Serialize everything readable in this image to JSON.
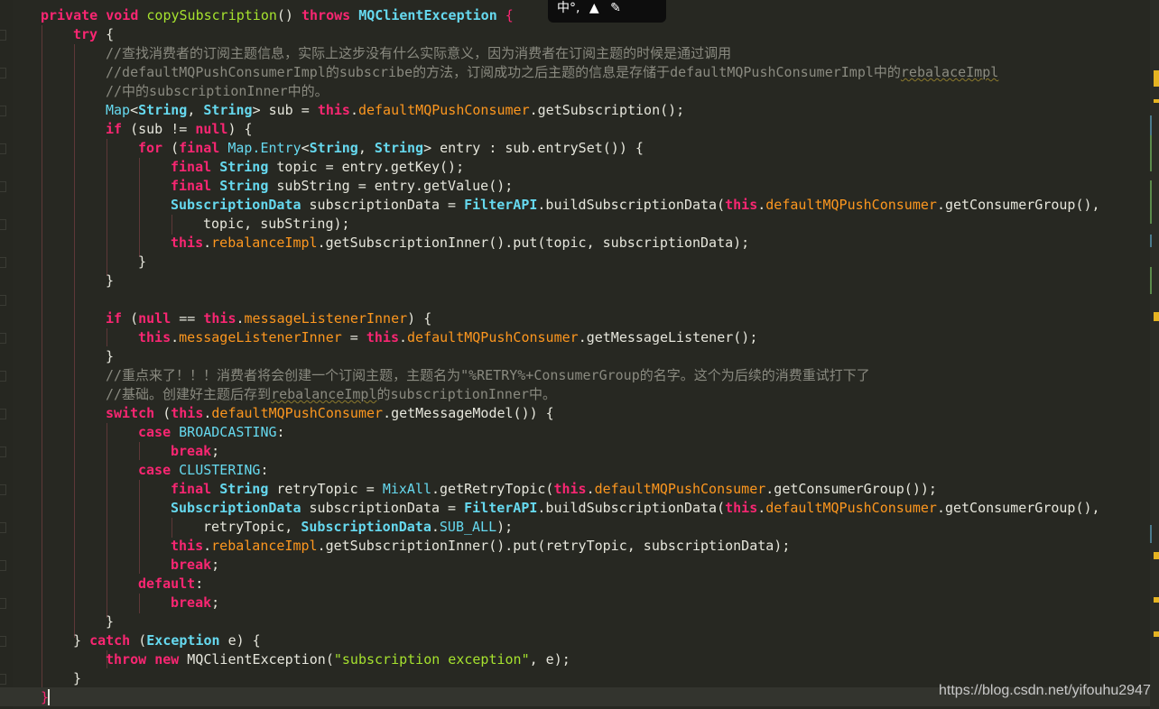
{
  "ime_toolbar": {
    "text": "中°,"
  },
  "watermark": "https://blog.csdn.net/yifouhu2947",
  "code": {
    "l1_private": "private",
    "l1_void": "void",
    "l1_name": "copySubscription",
    "l1_paren": "() ",
    "l1_throws": "throws",
    "l1_exc": "MQClientException",
    "l1_brace": " {",
    "l2_try": "try",
    "l2_brace": " {",
    "l3": "//查找消费者的订阅主题信息，实际上这步没有什么实际意义，因为消费者在订阅主题的时候是通过调用",
    "l4a": "//defaultMQPushConsumerImpl的subscribe的方法，订阅成功之后主题的信息是存储于defaultMQPushConsumerImpl中的",
    "l4b": "rebalaceImpl",
    "l5": "//中的subscriptionInner中的。",
    "l6_map": "Map",
    "l6_lt": "<",
    "l6_s1": "String",
    "l6_c": ", ",
    "l6_s2": "String",
    "l6_gt": "> sub = ",
    "l6_this": "this",
    "l6_dot": ".",
    "l6_fld": "defaultMQPushConsumer",
    "l6_rest": ".getSubscription();",
    "l7_if": "if",
    "l7_a": " (sub != ",
    "l7_null": "null",
    "l7_b": ") {",
    "l8_for": "for",
    "l8_a": " (",
    "l8_final": "final",
    "l8_sp": " ",
    "l8_map": "Map.Entry",
    "l8_lt": "<",
    "l8_s1": "String",
    "l8_c": ", ",
    "l8_s2": "String",
    "l8_rest": "> entry : sub.entrySet()) {",
    "l9_final": "final",
    "l9_str": "String",
    "l9_rest": " topic = entry.getKey();",
    "l10_final": "final",
    "l10_str": "String",
    "l10_rest": " subString = entry.getValue();",
    "l11_sd": "SubscriptionData",
    "l11_a": " subscriptionData = ",
    "l11_api": "FilterAPI",
    "l11_b": ".buildSubscriptionData(",
    "l11_this": "this",
    "l11_dot": ".",
    "l11_fld": "defaultMQPushConsumer",
    "l11_rest": ".getConsumerGroup(),",
    "l12": "topic, subString);",
    "l13_this": "this",
    "l13_dot": ".",
    "l13_fld": "rebalanceImpl",
    "l13_rest": ".getSubscriptionInner().put(topic, subscriptionData);",
    "l14": "}",
    "l15": "}",
    "l17_if": "if",
    "l17_a": " (",
    "l17_null": "null",
    "l17_b": " == ",
    "l17_this": "this",
    "l17_dot": ".",
    "l17_fld": "messageListenerInner",
    "l17_rest": ") {",
    "l18_this": "this",
    "l18_dot": ".",
    "l18_fld": "messageListenerInner",
    "l18_a": " = ",
    "l18_this2": "this",
    "l18_dot2": ".",
    "l18_fld2": "defaultMQPushConsumer",
    "l18_rest": ".getMessageListener();",
    "l19": "}",
    "l20": "//重点来了！！！消费者将会创建一个订阅主题，主题名为\"%RETRY%+ConsumerGroup的名字。这个为后续的消费重试打下了",
    "l21a": "//基础。创建好主题后存到",
    "l21b": "rebalanceImpl",
    "l21c": "的subscriptionInner中。",
    "l22_switch": "switch",
    "l22_a": " (",
    "l22_this": "this",
    "l22_dot": ".",
    "l22_fld": "defaultMQPushConsumer",
    "l22_rest": ".getMessageModel()) {",
    "l23_case": "case",
    "l23_const": "BROADCASTING",
    "l23_colon": ":",
    "l24_break": "break",
    "l24_semi": ";",
    "l25_case": "case",
    "l25_const": "CLUSTERING",
    "l25_colon": ":",
    "l26_final": "final",
    "l26_str": "String",
    "l26_a": " retryTopic = ",
    "l26_mix": "MixAll",
    "l26_b": ".getRetryTopic(",
    "l26_this": "this",
    "l26_dot": ".",
    "l26_fld": "defaultMQPushConsumer",
    "l26_rest": ".getConsumerGroup());",
    "l27_sd": "SubscriptionData",
    "l27_a": " subscriptionData = ",
    "l27_api": "FilterAPI",
    "l27_b": ".buildSubscriptionData(",
    "l27_this": "this",
    "l27_dot": ".",
    "l27_fld": "defaultMQPushConsumer",
    "l27_rest": ".getConsumerGroup(),",
    "l28_a": "retryTopic, ",
    "l28_sd": "SubscriptionData",
    "l28_dot": ".",
    "l28_const": "SUB_ALL",
    "l28_rest": ");",
    "l29_this": "this",
    "l29_dot": ".",
    "l29_fld": "rebalanceImpl",
    "l29_rest": ".getSubscriptionInner().put(retryTopic, subscriptionData);",
    "l30_break": "break",
    "l30_semi": ";",
    "l31_default": "default",
    "l31_colon": ":",
    "l32_break": "break",
    "l32_semi": ";",
    "l33": "}",
    "l34_a": "} ",
    "l34_catch": "catch",
    "l34_b": " (",
    "l34_exc": "Exception",
    "l34_rest": " e) {",
    "l35_throw": "throw",
    "l35_sp": " ",
    "l35_new": "new",
    "l35_a": " MQClientException(",
    "l35_str": "\"subscription exception\"",
    "l35_rest": ", e);",
    "l36": "}",
    "l37": "}"
  }
}
